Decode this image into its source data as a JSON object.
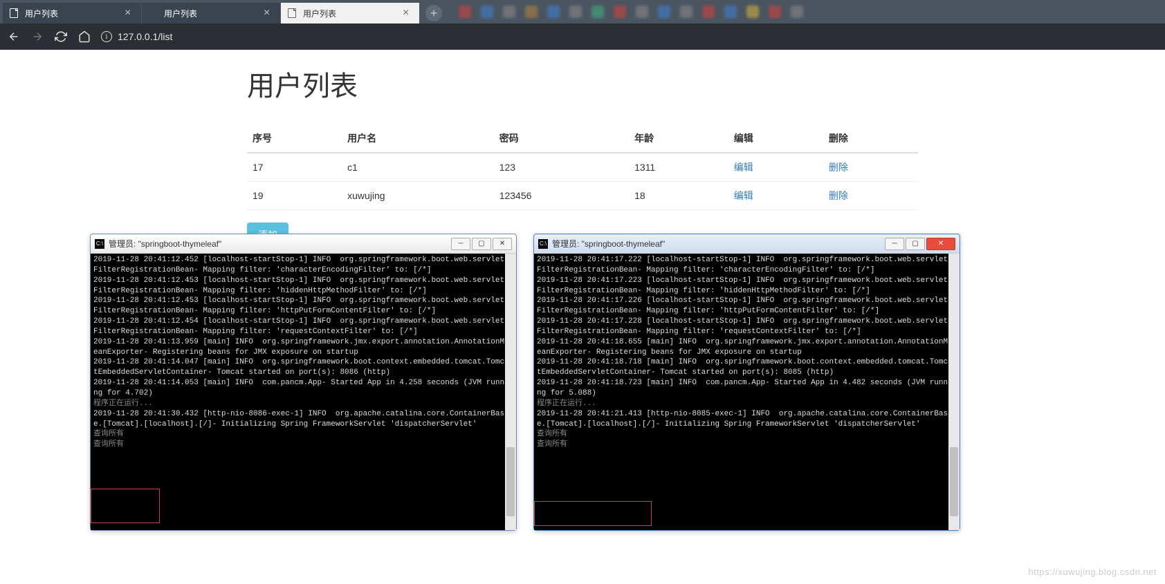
{
  "browser": {
    "tabs": [
      {
        "title": "用户列表",
        "active": false,
        "icon": "file"
      },
      {
        "title": "用户列表",
        "active": false,
        "icon": "leaf"
      },
      {
        "title": "用户列表",
        "active": true,
        "icon": "file"
      }
    ],
    "url": "127.0.0.1/list",
    "blur_colors": [
      "#d04040",
      "#4080d0",
      "#888",
      "#b08040",
      "#4080d0",
      "#888",
      "#40b080",
      "#d04040",
      "#888",
      "#4080d0",
      "#888",
      "#d04040",
      "#4080d0",
      "#d0b040",
      "#d04040",
      "#888"
    ]
  },
  "page": {
    "title": "用户列表",
    "headers": {
      "id": "序号",
      "name": "用户名",
      "pwd": "密码",
      "age": "年龄",
      "edit": "编辑",
      "del": "删除"
    },
    "rows": [
      {
        "id": "17",
        "name": "c1",
        "pwd": "123",
        "age": "1311",
        "edit": "编辑",
        "del": "删除"
      },
      {
        "id": "19",
        "name": "xuwujing",
        "pwd": "123456",
        "age": "18",
        "edit": "编辑",
        "del": "删除"
      }
    ],
    "add_label": "添加"
  },
  "consoles": [
    {
      "title": "管理员: \"springboot-thymeleaf\"",
      "style": "gray",
      "log": "2019-11-28 20:41:12.452 [localhost-startStop-1] INFO  org.springframework.boot.web.servlet.FilterRegistrationBean- Mapping filter: 'characterEncodingFilter' to: [/*]\n2019-11-28 20:41:12.453 [localhost-startStop-1] INFO  org.springframework.boot.web.servlet.FilterRegistrationBean- Mapping filter: 'hiddenHttpMethodFilter' to: [/*]\n2019-11-28 20:41:12.453 [localhost-startStop-1] INFO  org.springframework.boot.web.servlet.FilterRegistrationBean- Mapping filter: 'httpPutFormContentFilter' to: [/*]\n2019-11-28 20:41:12.454 [localhost-startStop-1] INFO  org.springframework.boot.web.servlet.FilterRegistrationBean- Mapping filter: 'requestContextFilter' to: [/*]\n2019-11-28 20:41:13.959 [main] INFO  org.springframework.jmx.export.annotation.AnnotationMBeanExporter- Registering beans for JMX exposure on startup\n2019-11-28 20:41:14.047 [main] INFO  org.springframework.boot.context.embedded.tomcat.TomcatEmbeddedServletContainer- Tomcat started on port(s): 8086 (http)\n2019-11-28 20:41:14.053 [main] INFO  com.pancm.App- Started App in 4.258 seconds (JVM running for 4.702)",
      "running": "程序正在运行...",
      "log2": "2019-11-28 20:41:30.432 [http-nio-8086-exec-1] INFO  org.apache.catalina.core.ContainerBase.[Tomcat].[localhost].[/]- Initializing Spring FrameworkServlet 'dispatcherServlet'",
      "query": "查询所有\n查询所有"
    },
    {
      "title": "管理员: \"springboot-thymeleaf\"",
      "style": "blue",
      "log": "2019-11-28 20:41:17.222 [localhost-startStop-1] INFO  org.springframework.boot.web.servlet.FilterRegistrationBean- Mapping filter: 'characterEncodingFilter' to: [/*]\n2019-11-28 20:41:17.223 [localhost-startStop-1] INFO  org.springframework.boot.web.servlet.FilterRegistrationBean- Mapping filter: 'hiddenHttpMethodFilter' to: [/*]\n2019-11-28 20:41:17.226 [localhost-startStop-1] INFO  org.springframework.boot.web.servlet.FilterRegistrationBean- Mapping filter: 'httpPutFormContentFilter' to: [/*]\n2019-11-28 20:41:17.228 [localhost-startStop-1] INFO  org.springframework.boot.web.servlet.FilterRegistrationBean- Mapping filter: 'requestContextFilter' to: [/*]\n2019-11-28 20:41:18.655 [main] INFO  org.springframework.jmx.export.annotation.AnnotationMBeanExporter- Registering beans for JMX exposure on startup\n2019-11-28 20:41:18.718 [main] INFO  org.springframework.boot.context.embedded.tomcat.TomcatEmbeddedServletContainer- Tomcat started on port(s): 8085 (http)\n2019-11-28 20:41:18.723 [main] INFO  com.pancm.App- Started App in 4.482 seconds (JVM running for 5.088)",
      "running": "程序正在运行...",
      "log2": "2019-11-28 20:41:21.413 [http-nio-8085-exec-1] INFO  org.apache.catalina.core.ContainerBase.[Tomcat].[localhost].[/]- Initializing Spring FrameworkServlet 'dispatcherServlet'",
      "query": "查询所有\n查询所有"
    }
  ],
  "watermark": "https://xuwujing.blog.csdn.net"
}
